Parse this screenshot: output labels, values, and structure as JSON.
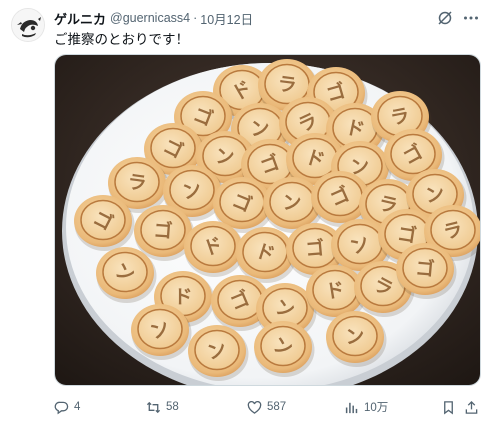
{
  "author": {
    "display_name": "ゲルニカ",
    "handle": "@guernicass4",
    "separator": "·",
    "date": "10月12日"
  },
  "tweet": {
    "text": "ご推察のとおりです！"
  },
  "media": {
    "description_icon": "photo-of-cookies",
    "cookie_labels": [
      "ド",
      "ラ",
      "ゴ",
      "ゴ",
      "ン",
      "ラ",
      "ド",
      "ラ",
      "ゴ",
      "ン",
      "ゴ",
      "ド",
      "ン",
      "ゴ",
      "ラ",
      "ン",
      "ゴ",
      "ン",
      "ゴ",
      "ラ",
      "ン",
      "ゴ",
      "ゴ",
      "ド",
      "ド",
      "ゴ",
      "ン",
      "ゴ",
      "ラ",
      "ン",
      "ド",
      "ゴ",
      "ン",
      "ド",
      "ラ",
      "ゴ",
      "ン",
      "ン",
      "ン",
      "ン"
    ]
  },
  "actions": {
    "reply_count": "4",
    "retweet_count": "58",
    "like_count": "587",
    "views_count": "10万"
  },
  "colors": {
    "text_primary": "#0f1419",
    "text_secondary": "#536471",
    "border": "#cfd9de"
  }
}
